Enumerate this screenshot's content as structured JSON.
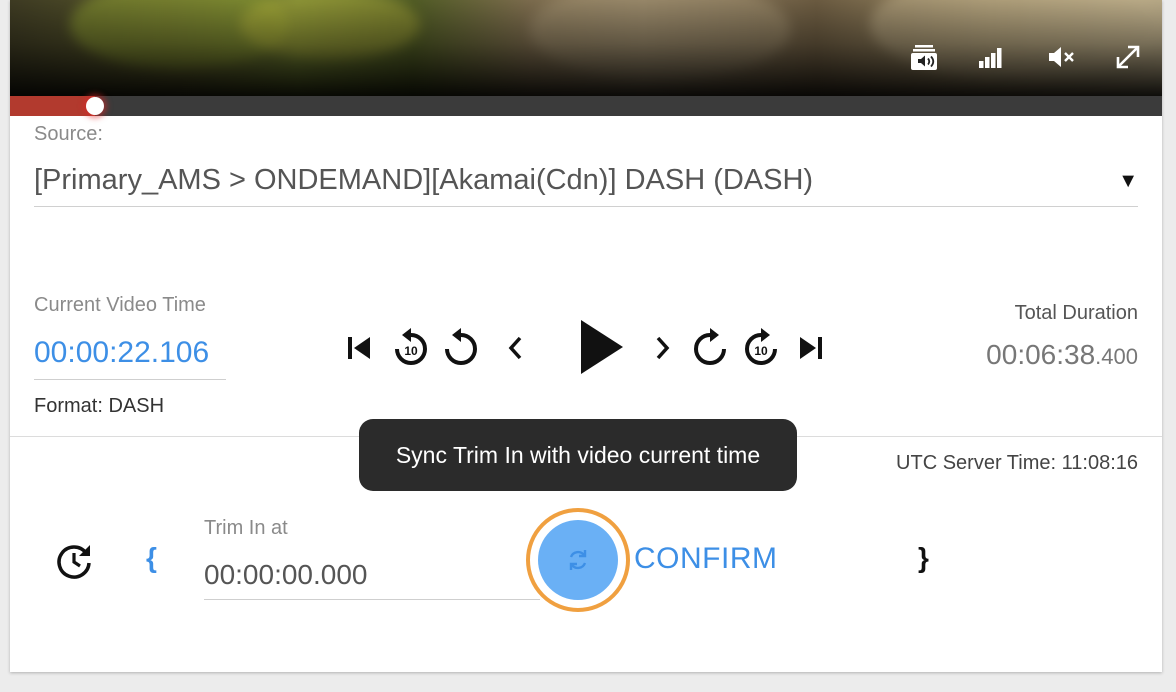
{
  "source": {
    "label": "Source:",
    "selected": "[Primary_AMS > ONDEMAND][Akamai(Cdn)] DASH (DASH)"
  },
  "player": {
    "progress_fraction": 0.074,
    "controls": [
      "audio-tracks-icon",
      "quality-icon",
      "mute-icon",
      "fullscreen-icon"
    ]
  },
  "current_time": {
    "label": "Current Video Time",
    "value": "00:00:22.106",
    "format": "Format: DASH"
  },
  "total_duration": {
    "label": "Total Duration",
    "value": "00:06:38",
    "ms": ".400"
  },
  "transport": {
    "buttons": [
      "skip-to-start-icon",
      "rewind-10-icon",
      "replay-icon",
      "step-back-icon",
      "play-icon",
      "step-forward-icon",
      "redo-icon",
      "forward-10-icon",
      "skip-to-end-icon"
    ],
    "ten_label": "10"
  },
  "utc": "UTC Server Time: 11:08:16",
  "tooltip": "Sync Trim In with video current time",
  "trim": {
    "label": "Trim In at",
    "value": "00:00:00.000",
    "open_brace": "{",
    "close_brace": "}",
    "confirm": "CONFIRM"
  },
  "colors": {
    "accent": "#3d8fe6",
    "progress": "#b23a2e",
    "sync_ring": "#f0a040",
    "tooltip_bg": "#2b2b2b"
  }
}
